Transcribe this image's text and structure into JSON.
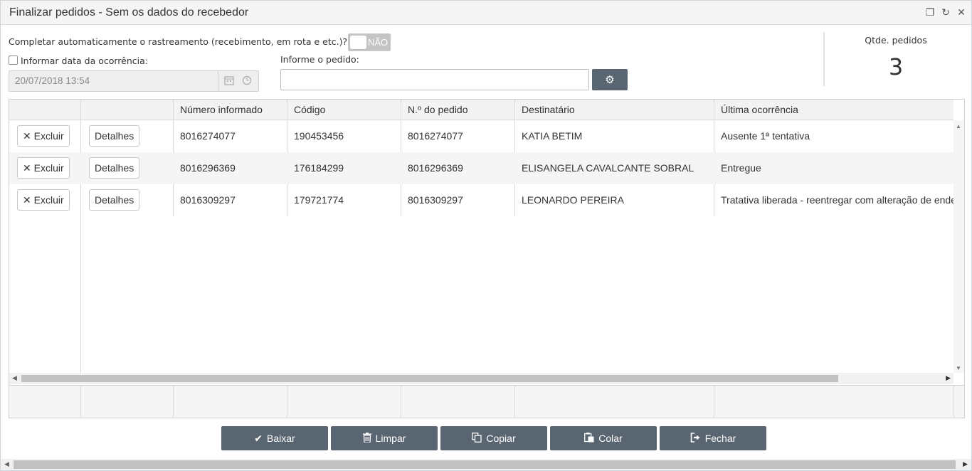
{
  "window": {
    "title": "Finalizar pedidos - Sem os dados do recebedor",
    "controls": [
      "restore-icon",
      "refresh-icon",
      "close-icon"
    ]
  },
  "options": {
    "auto_complete_label": "Completar automaticamente o rastreamento (recebimento, em rota e etc.)?",
    "toggle_state": "NÃO",
    "inform_date_label": "Informar data da ocorrência:",
    "date_value": "20/07/2018 13:54",
    "order_label": "Informe o pedido:",
    "order_value": ""
  },
  "count": {
    "label": "Qtde. pedidos",
    "value": "3"
  },
  "grid": {
    "columns": [
      "",
      "",
      "Número informado",
      "Código",
      "N.º do pedido",
      "Destinatário",
      "Última ocorrência"
    ],
    "delete_label": "Excluir",
    "details_label": "Detalhes",
    "rows": [
      {
        "numero": "8016274077",
        "codigo": "190453456",
        "pedido": "8016274077",
        "destinatario": "KATIA BETIM",
        "ocorrencia": "Ausente 1ª tentativa"
      },
      {
        "numero": "8016296369",
        "codigo": "176184299",
        "pedido": "8016296369",
        "destinatario": "ELISANGELA CAVALCANTE SOBRAL",
        "ocorrencia": "Entregue"
      },
      {
        "numero": "8016309297",
        "codigo": "179721774",
        "pedido": "8016309297",
        "destinatario": "LEONARDO PEREIRA",
        "ocorrencia": "Tratativa liberada - reentregar com alteração de ende"
      }
    ]
  },
  "actions": {
    "baixar": "Baixar",
    "limpar": "Limpar",
    "copiar": "Copiar",
    "colar": "Colar",
    "fechar": "Fechar"
  },
  "colors": {
    "button_bg": "#5a6572",
    "header_bg": "#f3f3f3",
    "alt_row_bg": "#f5f5f5"
  }
}
